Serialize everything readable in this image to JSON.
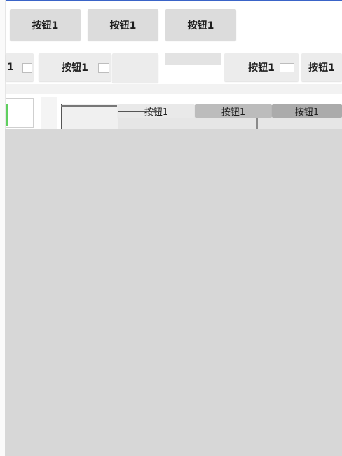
{
  "buttons": {
    "row1": [
      "按钮1",
      "按钮1",
      "按钮1"
    ],
    "row2": [
      "1",
      "按钮1",
      "按钮1",
      "按钮1"
    ],
    "row3": [
      "按钮1",
      "按钮1",
      "按钮1"
    ]
  }
}
